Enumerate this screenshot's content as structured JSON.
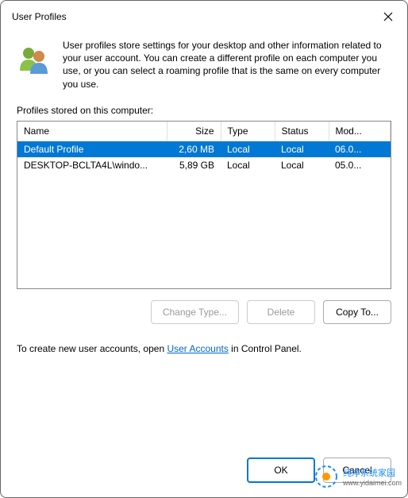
{
  "title": "User Profiles",
  "intro_text": "User profiles store settings for your desktop and other information related to your user account. You can create a different profile on each computer you use, or you can select a roaming profile that is the same on every computer you use.",
  "section_label": "Profiles stored on this computer:",
  "table": {
    "headers": {
      "name": "Name",
      "size": "Size",
      "type": "Type",
      "status": "Status",
      "modified": "Mod..."
    },
    "rows": [
      {
        "name": "Default Profile",
        "size": "2,60 MB",
        "type": "Local",
        "status": "Local",
        "modified": "06.0...",
        "selected": true
      },
      {
        "name": "DESKTOP-BCLTA4L\\windo...",
        "size": "5,89 GB",
        "type": "Local",
        "status": "Local",
        "modified": "05.0...",
        "selected": false
      }
    ]
  },
  "buttons": {
    "change_type": "Change Type...",
    "delete": "Delete",
    "copy_to": "Copy To..."
  },
  "footer": {
    "prefix": "To create new user accounts, open ",
    "link": "User Accounts",
    "suffix": " in Control Panel."
  },
  "dialog": {
    "ok": "OK",
    "cancel": "Cancel"
  },
  "watermark": {
    "line1": "纯净系统家园",
    "line2": "www.yidaimei.com"
  }
}
